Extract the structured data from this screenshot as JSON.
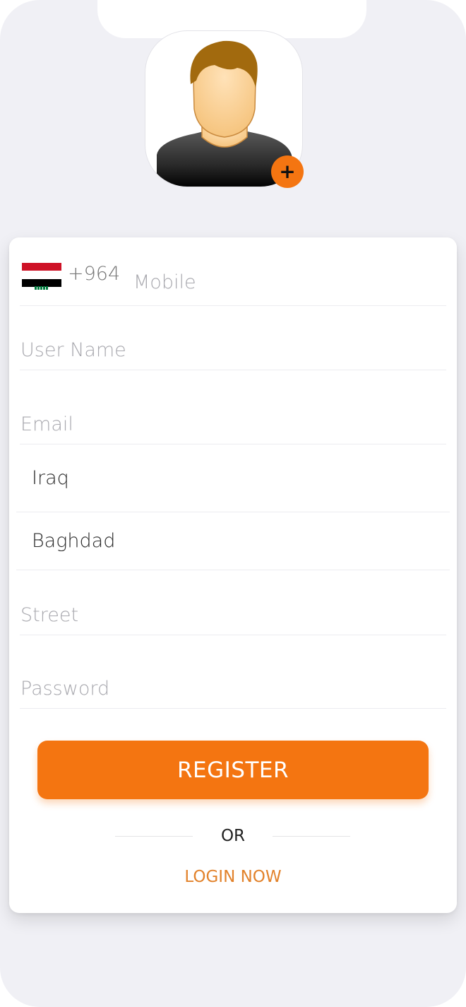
{
  "colors": {
    "accent": "#f47511",
    "link": "#e2822b",
    "background": "#f0f0f5"
  },
  "avatar": {
    "add_icon": "plus-icon",
    "add_label": "+"
  },
  "phone": {
    "country_code": "+964",
    "placeholder": "Mobile",
    "flag": "iraq-flag-icon"
  },
  "form": {
    "username_placeholder": "User Name",
    "email_placeholder": "Email",
    "country_value": "Iraq",
    "city_value": "Baghdad",
    "street_placeholder": "Street",
    "password_placeholder": "Password"
  },
  "actions": {
    "register_label": "REGISTER",
    "or_label": "OR",
    "login_label": "LOGIN NOW"
  }
}
